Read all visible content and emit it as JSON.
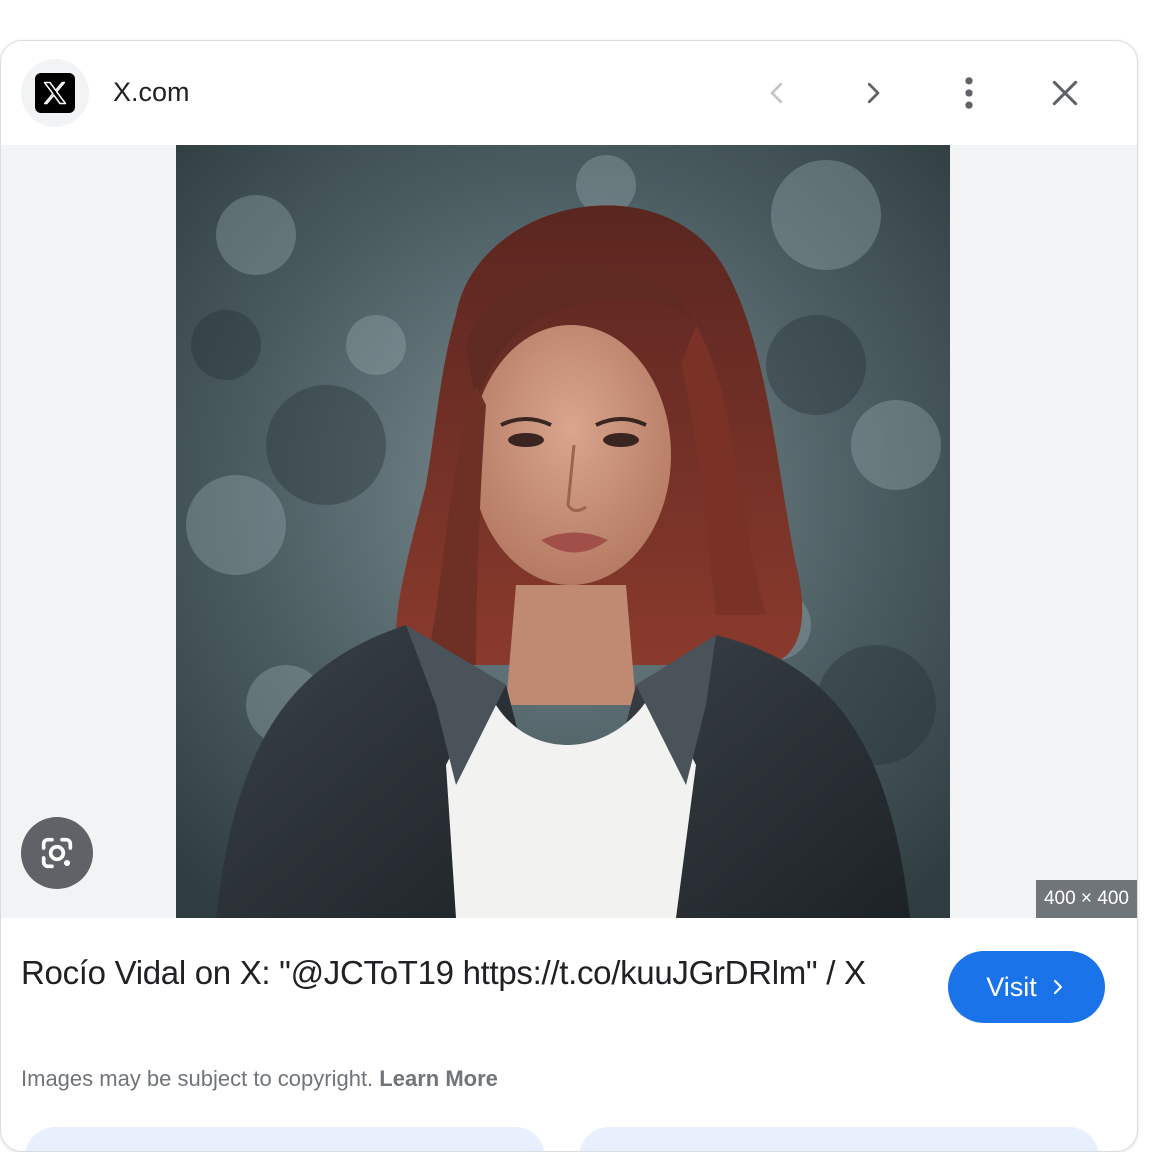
{
  "header": {
    "site_name": "X.com",
    "logo_icon": "x-logo-icon",
    "buttons": {
      "prev": "chevron-left-icon",
      "next": "chevron-right-icon",
      "more": "more-vert-icon",
      "close": "close-icon"
    }
  },
  "image": {
    "dimensions": "400 × 400",
    "lens_icon": "google-lens-icon"
  },
  "result": {
    "title": "Rocío Vidal on X: \"@JCToT19 https://t.co/kuuJGrDRlm\" / X",
    "visit_label": "Visit",
    "copyright_text": "Images may be subject to copyright.",
    "learn_more": "Learn More"
  },
  "colors": {
    "accent": "#1a73e8",
    "muted_text": "#70757a",
    "image_bg": "#f1f3f4"
  }
}
